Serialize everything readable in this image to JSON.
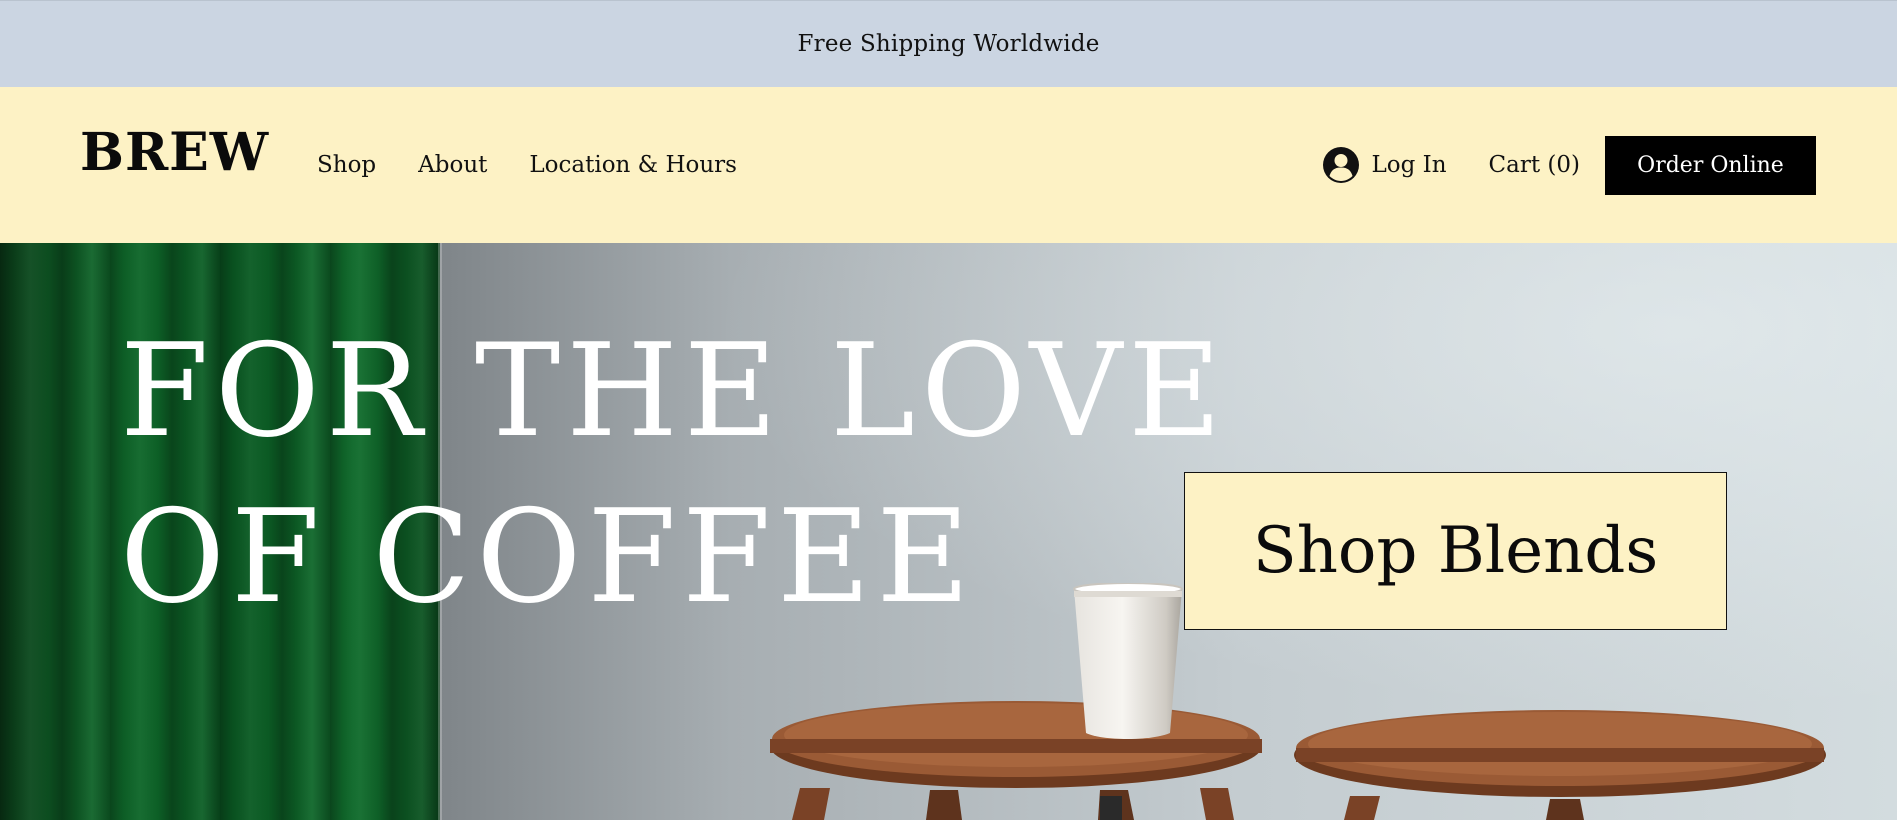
{
  "announcement": {
    "text": "Free Shipping Worldwide"
  },
  "header": {
    "logo": "BREW",
    "nav": [
      {
        "label": "Shop"
      },
      {
        "label": "About"
      },
      {
        "label": "Location & Hours"
      }
    ],
    "login_label": "Log In",
    "login_icon": "user-circle-icon",
    "cart_label": "Cart (0)",
    "order_button_label": "Order Online"
  },
  "hero": {
    "heading_line1": "FOR THE LOVE",
    "heading_line2": "OF COFFEE",
    "cta_label": "Shop Blends"
  },
  "colors": {
    "announcement_bg": "#cbd5e2",
    "header_bg": "#fdf2c5",
    "button_bg": "#000000",
    "cta_bg": "#fdf2c5",
    "curtain_green": "#0f6a2b",
    "table_wood": "#8a4f2d"
  }
}
